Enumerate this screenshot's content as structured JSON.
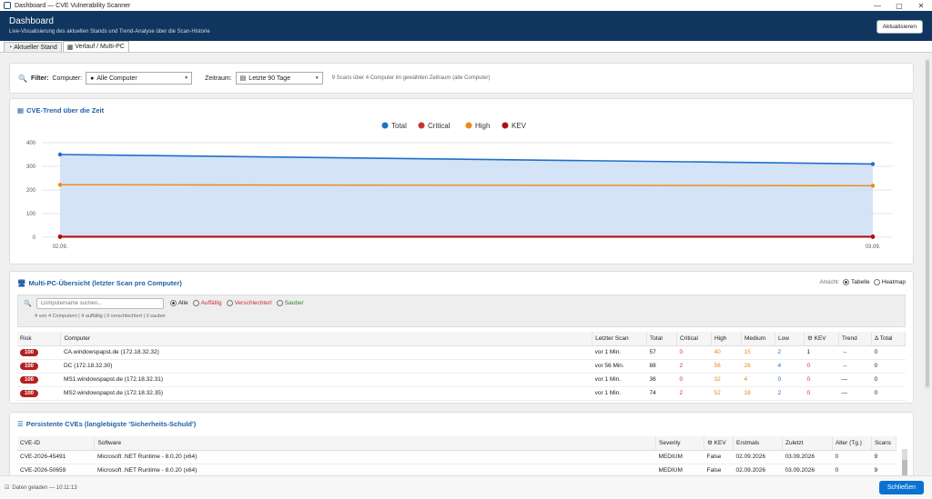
{
  "window": {
    "title": "Dashboard — CVE Vulnerability Scanner"
  },
  "header": {
    "title": "Dashboard",
    "subtitle": "Live-Visualisierung des aktuellen Stands und Trend-Analyse über die Scan-Historie",
    "refresh_label": "Aktualisieren"
  },
  "tabs": [
    {
      "label": "Aktueller Stand"
    },
    {
      "label": "Verlauf / Multi-PC"
    }
  ],
  "filter": {
    "label": "Filter:",
    "computer_label": "Computer:",
    "computer_value": "Alle Computer",
    "zeitraum_label": "Zeitraum:",
    "zeitraum_value": "Letzte 90 Tage",
    "info": "9 Scans über 4 Computer im gewählten Zeitraum (alle Computer)"
  },
  "trend": {
    "title": "CVE-Trend über die Zeit"
  },
  "chart_data": {
    "type": "line",
    "x": [
      "02.09.",
      "03.09."
    ],
    "series": [
      {
        "name": "Total",
        "color": "#1f6fc8",
        "values": [
          350,
          310
        ]
      },
      {
        "name": "Critical",
        "color": "#d03030",
        "values": [
          4,
          4
        ]
      },
      {
        "name": "High",
        "color": "#ef8a10",
        "values": [
          222,
          218
        ]
      },
      {
        "name": "KEV",
        "color": "#b01010",
        "values": [
          1,
          1
        ]
      }
    ],
    "yticks": [
      "400",
      "300",
      "200",
      "100",
      "0"
    ],
    "ylim": [
      0,
      400
    ],
    "legend": "top-center",
    "grid": true
  },
  "multipc": {
    "title": "Multi-PC-Übersicht (letzter Scan pro Computer)",
    "view_label": "Ansicht:",
    "view_table": "Tabelle",
    "view_heatmap": "Heatmap",
    "search_placeholder": "Computername suchen...",
    "radio_all": "Alle",
    "radio_auffaellig": "Auffällig",
    "radio_verschlechtert": "Verschlechtert",
    "radio_sauber": "Sauber",
    "stats_count": "4 von 4 Computern",
    "stats_auffaellig": "4 auffällig",
    "stats_verschlechtert": "0 verschlechtert",
    "stats_sauber": "0 sauber",
    "columns": [
      "Risk",
      "Computer",
      "Letzter Scan",
      "Total",
      "Critical",
      "High",
      "Medium",
      "Low",
      "KEV",
      "Trend",
      "Δ Total"
    ],
    "rows": [
      {
        "risk": "100",
        "computer": "CA.windowspapst.de (172.18.32.32)",
        "scan": "vor 1 Min.",
        "total": "57",
        "critical": "0",
        "high": "40",
        "medium": "15",
        "low": "2",
        "kev": "1",
        "trend": "→",
        "delta": "0"
      },
      {
        "risk": "100",
        "computer": "DC (172.18.32.30)",
        "scan": "vor 56 Min.",
        "total": "88",
        "critical": "2",
        "high": "56",
        "medium": "26",
        "low": "4",
        "kev": "0",
        "trend": "→",
        "delta": "0"
      },
      {
        "risk": "100",
        "computer": "MS1.windowspapst.de (172.18.32.31)",
        "scan": "vor 1 Min.",
        "total": "36",
        "critical": "0",
        "high": "32",
        "medium": "4",
        "low": "0",
        "kev": "0",
        "trend": "—",
        "delta": "0"
      },
      {
        "risk": "100",
        "computer": "MS2.windowspapst.de (172.18.32.35)",
        "scan": "vor 1 Min.",
        "total": "74",
        "critical": "2",
        "high": "52",
        "medium": "18",
        "low": "2",
        "kev": "0",
        "trend": "—",
        "delta": "0"
      }
    ]
  },
  "persistent": {
    "title": "Persistente CVEs (langlebigste 'Sicherheits-Schuld')",
    "columns": [
      "CVE-ID",
      "Software",
      "Severity",
      "KEV",
      "Erstmals",
      "Zuletzt",
      "Alter (Tg.)",
      "Scans"
    ],
    "rows": [
      {
        "cve": "CVE-2026-45491",
        "software": "Microsoft .NET Runtime - 8.0.20 (x64)",
        "severity": "MEDIUM",
        "kev": "False",
        "first": "02.09.2026",
        "last": "03.09.2026",
        "age": "0",
        "scans": "9"
      },
      {
        "cve": "CVE-2026-50659",
        "software": "Microsoft .NET Runtime - 8.0.20 (x64)",
        "severity": "MEDIUM",
        "kev": "False",
        "first": "02.09.2026",
        "last": "03.09.2026",
        "age": "0",
        "scans": "9"
      }
    ]
  },
  "footer": {
    "status": "Daten geladen — 10:11:13",
    "close_label": "Schließen"
  }
}
